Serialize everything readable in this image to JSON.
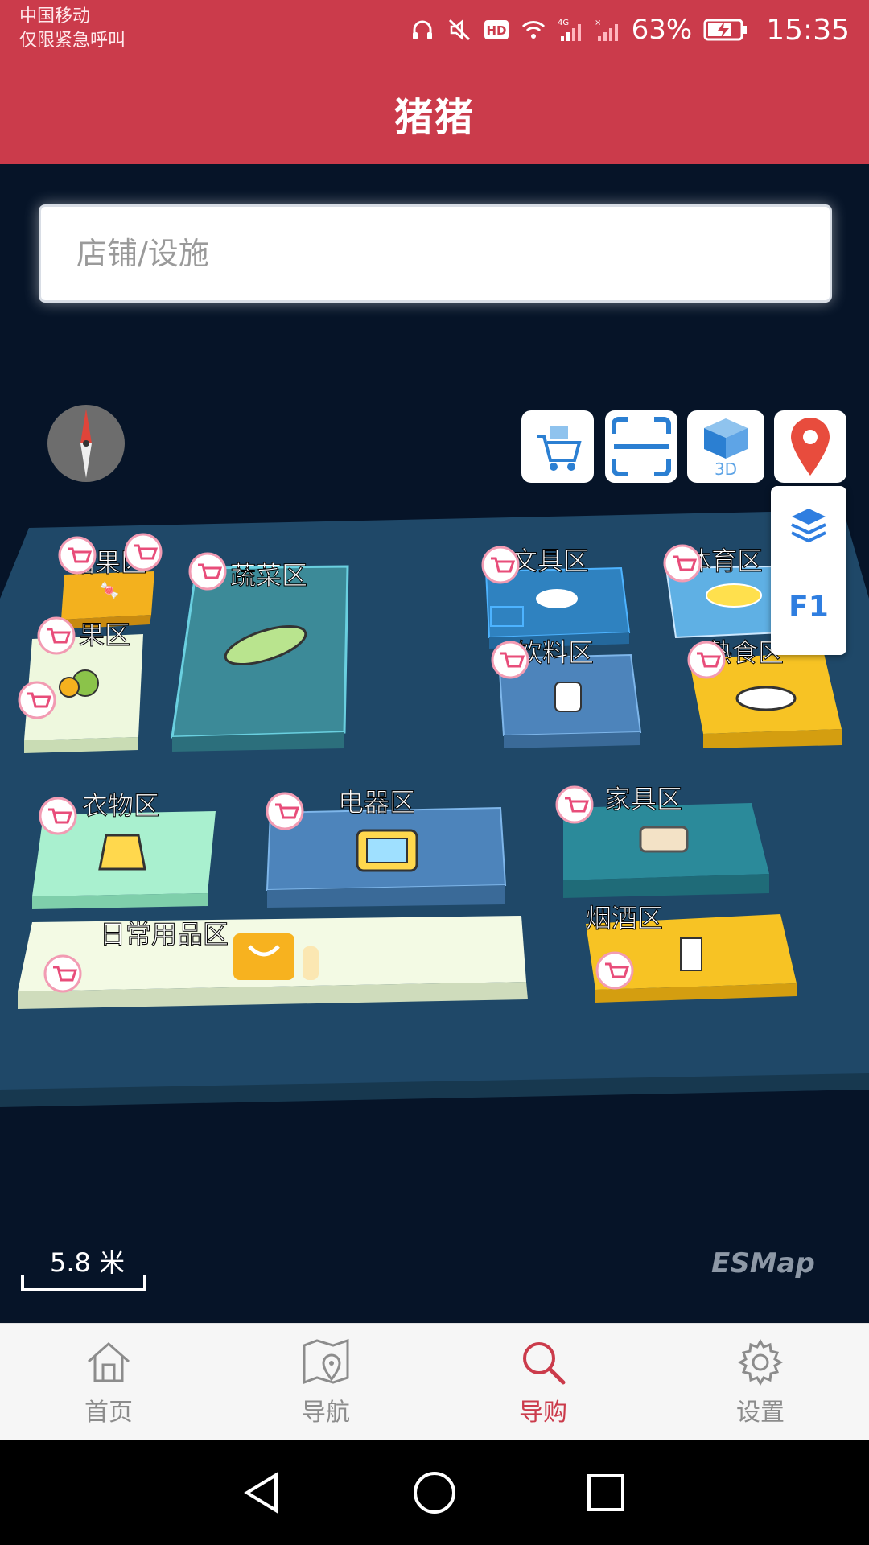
{
  "status_bar": {
    "carrier_line1": "中国移动",
    "carrier_line2": "仅限紧急呼叫",
    "battery_percent": "63%",
    "time": "15:35",
    "icons": [
      "headphones-icon",
      "mute-icon",
      "hd-icon",
      "wifi-icon",
      "signal-4g-icon",
      "no-signal-icon",
      "battery-charging-icon"
    ]
  },
  "header": {
    "title": "猪猪"
  },
  "search": {
    "placeholder": "店铺/设施"
  },
  "map_tools": {
    "buttons": [
      "cart-tool-icon",
      "scan-icon",
      "3d-view-icon",
      "location-pin-icon"
    ],
    "three_d_label": "3D",
    "floor": "F1",
    "layers_icon": "layers-icon"
  },
  "zones": {
    "candy": "糖果区",
    "vegetable": "蔬菜区",
    "stationery": "文具区",
    "sports": "体育区",
    "fruit": "果区",
    "drinks": "饮料区",
    "deli": "熟食区",
    "clothes": "衣物区",
    "appliances": "电器区",
    "furniture": "家具区",
    "daily": "日常用品区",
    "tobacco": "烟酒区"
  },
  "scale": {
    "label": "5.8 米"
  },
  "logo": "ESMap",
  "bottom_nav": {
    "items": [
      {
        "label": "首页",
        "icon": "home-icon"
      },
      {
        "label": "导航",
        "icon": "map-pin-icon"
      },
      {
        "label": "导购",
        "icon": "search-icon",
        "active": true
      },
      {
        "label": "设置",
        "icon": "gear-icon"
      }
    ]
  },
  "colors": {
    "accent": "#cb3b4b",
    "map_bg": "#061428",
    "floor_plate": "#1f4868"
  }
}
